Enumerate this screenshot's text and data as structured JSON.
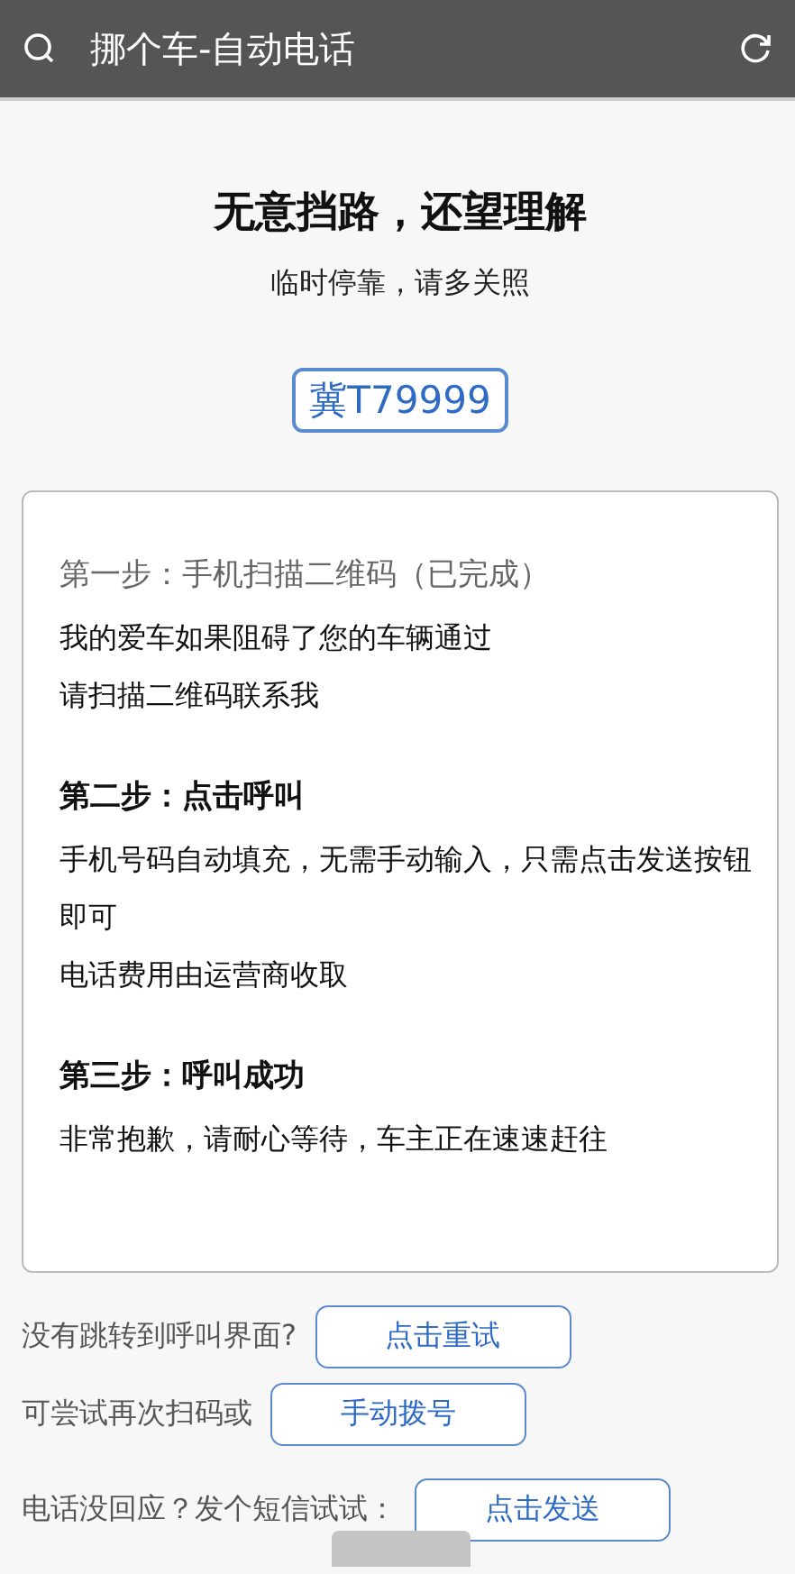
{
  "app_bar": {
    "title": "挪个车-自动电话"
  },
  "heading": {
    "title": "无意挡路，还望理解",
    "subtitle": "临时停靠，请多关照"
  },
  "plate": {
    "label": "冀T79999"
  },
  "steps": [
    {
      "title": "第一步：手机扫描二维码（已完成）",
      "done": true,
      "lines": [
        "我的爱车如果阻碍了您的车辆通过",
        "请扫描二维码联系我"
      ]
    },
    {
      "title": "第二步：点击呼叫",
      "done": false,
      "lines": [
        "手机号码自动填充，无需手动输入，只需点击发送按钮即可",
        "电话费用由运营商收取"
      ]
    },
    {
      "title": "第三步：呼叫成功",
      "done": false,
      "lines": [
        "非常抱歉，请耐心等待，车主正在速速赶往"
      ]
    }
  ],
  "actions": [
    {
      "prompt": "没有跳转到呼叫界面?",
      "button": "点击重试"
    },
    {
      "prompt": "可尝试再次扫码或",
      "button": "手动拨号"
    },
    {
      "prompt": "电话没回应？发个短信试试：",
      "button": "点击发送"
    }
  ]
}
